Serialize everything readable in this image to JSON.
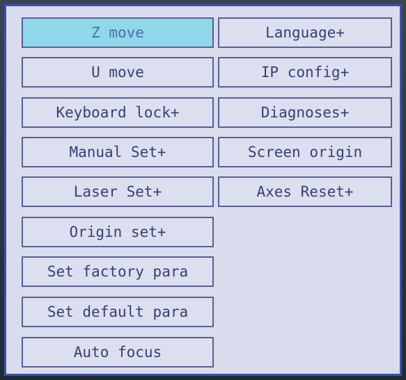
{
  "menu": {
    "left": [
      {
        "label": "Z move",
        "selected": true
      },
      {
        "label": "U move"
      },
      {
        "label": "Keyboard lock+"
      },
      {
        "label": "Manual Set+"
      },
      {
        "label": "Laser Set+"
      },
      {
        "label": "Origin set+"
      },
      {
        "label": "Set factory para"
      },
      {
        "label": "Set default para"
      },
      {
        "label": "Auto focus"
      }
    ],
    "right": [
      {
        "label": "Language+"
      },
      {
        "label": "IP config+"
      },
      {
        "label": "Diagnoses+"
      },
      {
        "label": "Screen origin"
      },
      {
        "label": "Axes Reset+"
      }
    ]
  },
  "colors": {
    "screen_bg": "#d9dcec",
    "button_border": "#5a5e96",
    "button_text": "#3a3e70",
    "selected_bg": "#8ed8ea",
    "frame_border": "#3d4fb0"
  }
}
